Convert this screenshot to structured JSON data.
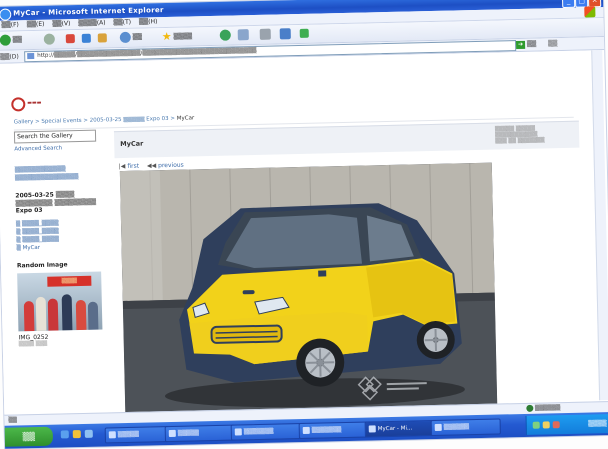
{
  "window": {
    "title": "MyCar - Microsoft Internet Explorer"
  },
  "menubar": [
    "▒▒(F)",
    "▒▒(E)",
    "▒▒(V)",
    "▒▒▒▒(A)",
    "▒▒(T)",
    "▒▒(H)"
  ],
  "toolbar": {
    "back": "▒▒",
    "search": "▒▒",
    "favorites": "▒▒▒▒"
  },
  "address": {
    "label": "▒▒(D)",
    "url": "http://▒▒▒▒▒/▒▒▒▒▒▒▒▒▒▒▒▒▒▒▒/▒▒▒▒▒▒▒▒▒▒▒▒▒▒▒▒▒▒▒▒▒▒▒▒▒▒▒",
    "go": "▒▒",
    "links": "▒▒"
  },
  "breadcrumb": {
    "items": [
      "Gallery",
      "Special Events",
      "2005-03-25 ▒▒▒▒▒ Expo 03"
    ],
    "current": "MyCar"
  },
  "sidebar": {
    "search_label": "Search the Gallery",
    "advanced": "Advanced Search",
    "links": [
      "▒▒▒▒▒▒▒▒▒▒▒▒",
      "▒▒▒▒▒▒▒▒▒▒▒▒▒▒▒"
    ],
    "category": "2005-03-25 ▒▒▒▒ ▒▒▒▒▒▒▒▒ ▒▒▒▒▒▒▒▒▒ Expo 03",
    "sub_items": [
      "▒ ▒▒▒▒_▒▒▒▒",
      "▒ ▒▒▒▒_▒▒▒▒",
      "▒ ▒▒▒▒_▒▒▒▒",
      "▒ MyCar"
    ],
    "random_title": "Random Image",
    "thumb_sign": "▒▒▒▒",
    "thumb_name": "IMG_0252",
    "thumb_meta": "▒▒▒▒ ▒▒▒"
  },
  "main": {
    "title": "MyCar",
    "meta": [
      "▒▒▒▒▒ ▒▒▒▒▒ ▒▒▒▒▒▒▒▒▒▒▒",
      "▒▒▒ ▒▒ ▒▒▒▒▒▒▒"
    ],
    "nav_first": "first",
    "nav_prev": "previous"
  },
  "statusbar": {
    "left": "▒▒",
    "right": "▒▒▒▒▒▒"
  },
  "taskbar": {
    "start": "▒▒",
    "tasks": [
      "▒▒▒▒▒",
      "▒▒▒▒▒",
      "▒▒▒▒▒▒▒",
      "▒▒▒▒▒▒▒",
      "MyCar - Mi...",
      "▒▒▒▒▒▒"
    ],
    "clock": "▒▒▒▒"
  },
  "colors": {
    "accent": "#245ad1",
    "link": "#3a6aa8",
    "car_body": "#f2d21a",
    "car_dark": "#2f3f5c"
  }
}
